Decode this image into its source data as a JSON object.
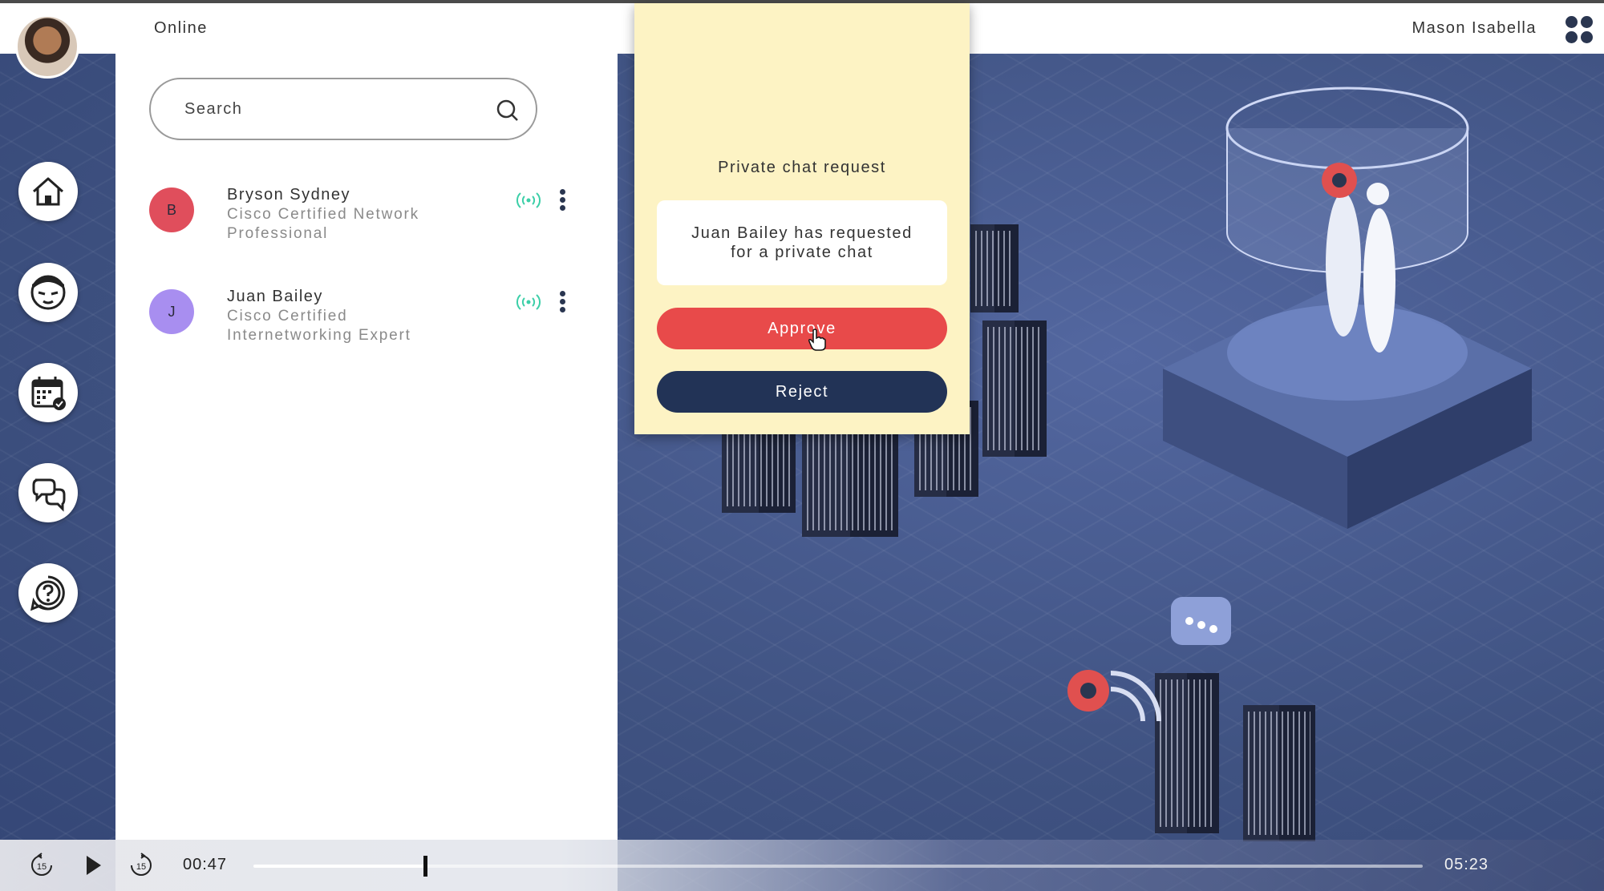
{
  "header": {
    "status": "Online",
    "user_name": "Mason Isabella"
  },
  "rail": {
    "items": [
      {
        "icon": "home-icon"
      },
      {
        "icon": "face-icon"
      },
      {
        "icon": "calendar-icon"
      },
      {
        "icon": "chat-icon"
      },
      {
        "icon": "help-icon"
      }
    ]
  },
  "search": {
    "placeholder": "Search"
  },
  "contacts": [
    {
      "initial": "B",
      "name": "Bryson Sydney",
      "role": "Cisco Certified Network Professional",
      "color": "#e04e5c"
    },
    {
      "initial": "J",
      "name": "Juan Bailey",
      "role": "Cisco Certified Internetworking Expert",
      "color": "#a88ef0"
    }
  ],
  "modal": {
    "title": "Private chat request",
    "message": "Juan Bailey has requested for a private chat",
    "approve_label": "Approve",
    "reject_label": "Reject"
  },
  "player": {
    "current_time": "00:47",
    "total_time": "05:23",
    "progress": 0.147,
    "rewind_label": "15",
    "forward_label": "15"
  },
  "colors": {
    "approve": "#e84a4a",
    "reject": "#223356",
    "signal": "#3ccfa8",
    "modal_bg": "#fdf3c4"
  }
}
